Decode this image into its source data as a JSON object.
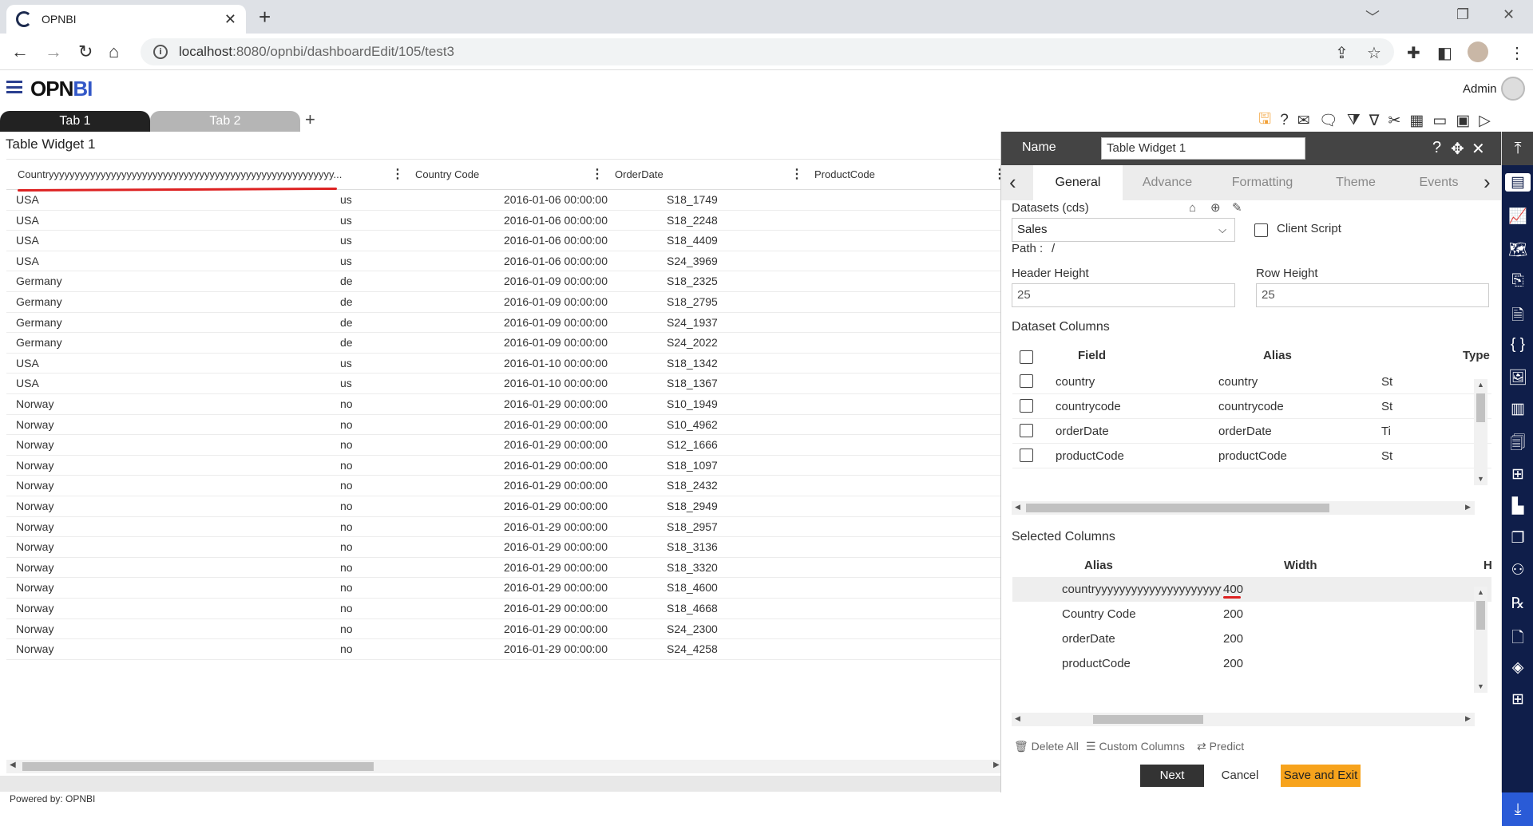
{
  "browser": {
    "tab_title": "OPNBI",
    "tab_close": "✕",
    "new_tab": "+",
    "url_host": "localhost",
    "url_rest": ":8080/opnbi/dashboardEdit/105/test3",
    "win_min": "﹀",
    "win_max": "❐",
    "win_close": "✕"
  },
  "app": {
    "logo_main": "OPN",
    "logo_accent": "BI",
    "user": "Admin"
  },
  "dashboard_tabs": [
    "Tab 1",
    "Tab 2"
  ],
  "add_tab": "+",
  "widget": {
    "title": "Table Widget 1",
    "columns": [
      "Countryyyyyyyyyyyyyyyyyyyyyyyyyyyyyyyyyyyyyyyyyyyyyyyyyyyyyyy...",
      "Country Code",
      "OrderDate",
      "ProductCode"
    ],
    "column_menu": "⋮",
    "rows": [
      [
        "USA",
        "us",
        "2016-01-06 00:00:00",
        "S18_1749"
      ],
      [
        "USA",
        "us",
        "2016-01-06 00:00:00",
        "S18_2248"
      ],
      [
        "USA",
        "us",
        "2016-01-06 00:00:00",
        "S18_4409"
      ],
      [
        "USA",
        "us",
        "2016-01-06 00:00:00",
        "S24_3969"
      ],
      [
        "Germany",
        "de",
        "2016-01-09 00:00:00",
        "S18_2325"
      ],
      [
        "Germany",
        "de",
        "2016-01-09 00:00:00",
        "S18_2795"
      ],
      [
        "Germany",
        "de",
        "2016-01-09 00:00:00",
        "S24_1937"
      ],
      [
        "Germany",
        "de",
        "2016-01-09 00:00:00",
        "S24_2022"
      ],
      [
        "USA",
        "us",
        "2016-01-10 00:00:00",
        "S18_1342"
      ],
      [
        "USA",
        "us",
        "2016-01-10 00:00:00",
        "S18_1367"
      ],
      [
        "Norway",
        "no",
        "2016-01-29 00:00:00",
        "S10_1949"
      ],
      [
        "Norway",
        "no",
        "2016-01-29 00:00:00",
        "S10_4962"
      ],
      [
        "Norway",
        "no",
        "2016-01-29 00:00:00",
        "S12_1666"
      ],
      [
        "Norway",
        "no",
        "2016-01-29 00:00:00",
        "S18_1097"
      ],
      [
        "Norway",
        "no",
        "2016-01-29 00:00:00",
        "S18_2432"
      ],
      [
        "Norway",
        "no",
        "2016-01-29 00:00:00",
        "S18_2949"
      ],
      [
        "Norway",
        "no",
        "2016-01-29 00:00:00",
        "S18_2957"
      ],
      [
        "Norway",
        "no",
        "2016-01-29 00:00:00",
        "S18_3136"
      ],
      [
        "Norway",
        "no",
        "2016-01-29 00:00:00",
        "S18_3320"
      ],
      [
        "Norway",
        "no",
        "2016-01-29 00:00:00",
        "S18_4600"
      ],
      [
        "Norway",
        "no",
        "2016-01-29 00:00:00",
        "S18_4668"
      ],
      [
        "Norway",
        "no",
        "2016-01-29 00:00:00",
        "S24_2300"
      ],
      [
        "Norway",
        "no",
        "2016-01-29 00:00:00",
        "S24_4258"
      ]
    ]
  },
  "footer": "Powered by: OPNBI",
  "panel": {
    "name_label": "Name",
    "name_value": "Table Widget 1",
    "tabs": [
      "General",
      "Advance",
      "Formatting",
      "Theme",
      "Events"
    ],
    "active_tab": "General",
    "datasets_label": "Datasets (cds)",
    "dataset_value": "Sales",
    "client_script": "Client Script",
    "path_label": "Path :",
    "path_value": "/",
    "header_height_label": "Header Height",
    "header_height_value": "25",
    "row_height_label": "Row Height",
    "row_height_value": "25",
    "dataset_columns_label": "Dataset Columns",
    "dataset_columns_headers": [
      "Field",
      "Alias",
      "Type"
    ],
    "dataset_columns": [
      {
        "field": "country",
        "alias": "country",
        "type": "St"
      },
      {
        "field": "countrycode",
        "alias": "countrycode",
        "type": "St"
      },
      {
        "field": "orderDate",
        "alias": "orderDate",
        "type": "Ti"
      },
      {
        "field": "productCode",
        "alias": "productCode",
        "type": "St"
      }
    ],
    "selected_columns_label": "Selected Columns",
    "selected_columns_headers": [
      "Alias",
      "Width",
      "H"
    ],
    "selected_columns": [
      {
        "alias": "countryyyyyyyyyyyyyyyyyyyyyyyyyy...",
        "width": "400"
      },
      {
        "alias": "Country Code",
        "width": "200"
      },
      {
        "alias": "orderDate",
        "width": "200"
      },
      {
        "alias": "productCode",
        "width": "200"
      }
    ],
    "delete_all": "Delete All",
    "custom_columns": "Custom Columns",
    "predict": "Predict",
    "next": "Next",
    "cancel": "Cancel",
    "save_exit": "Save and Exit"
  },
  "icons": {
    "rail": [
      "collapse-up-icon",
      "table-icon",
      "chart-icon",
      "map-icon",
      "doc-icon",
      "page-icon",
      "code-icon",
      "image-icon",
      "layout-icon",
      "report-icon",
      "tree-icon",
      "bar-chart-icon",
      "copy-icon",
      "network-icon",
      "rx-icon",
      "file-icon",
      "layers-icon",
      "grid-plus-icon",
      "download-icon"
    ]
  },
  "colors": {
    "accent": "#f7a31c",
    "rail": "#0f1e4a",
    "header": "#444444",
    "annotation": "#dd2222"
  }
}
